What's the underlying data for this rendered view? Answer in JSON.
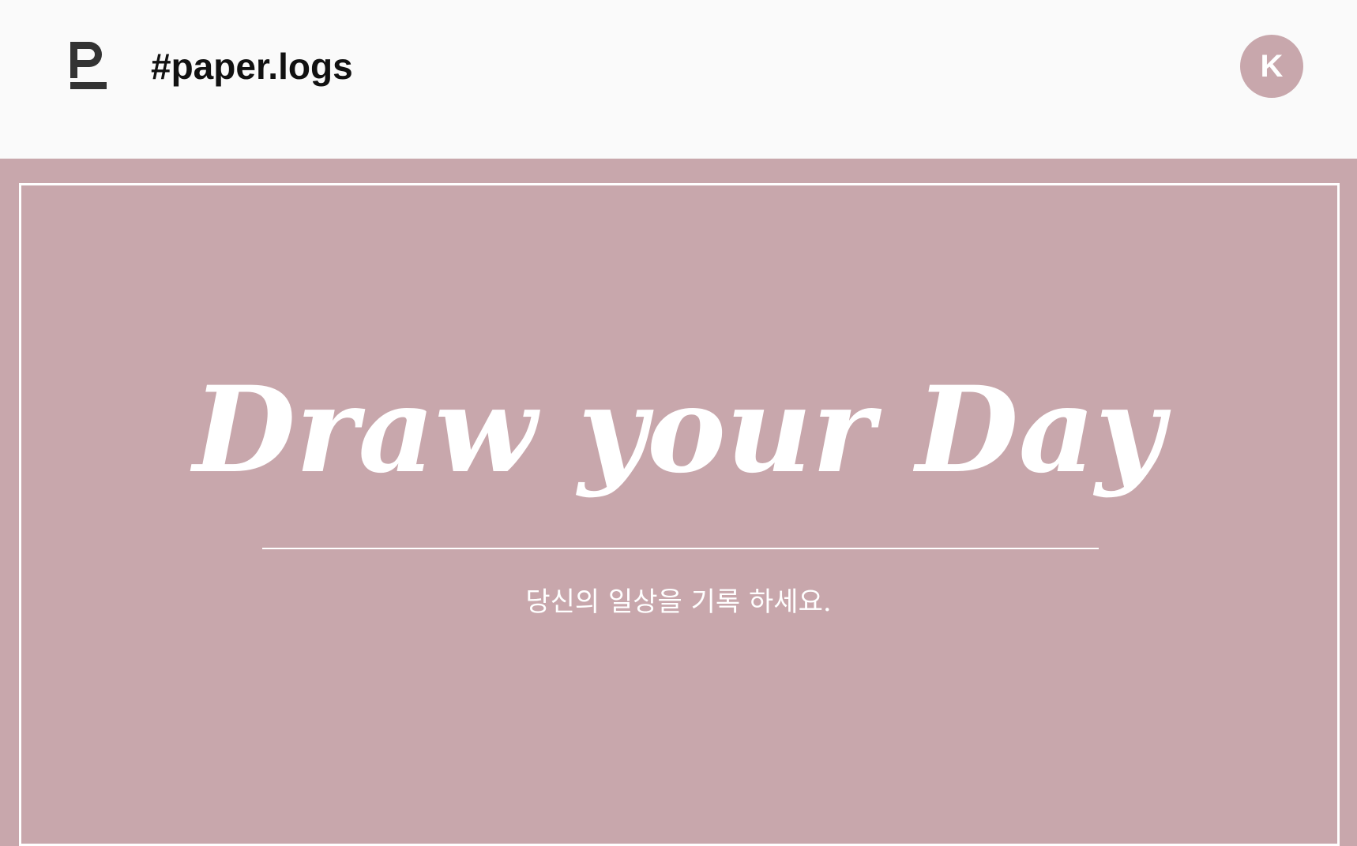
{
  "header": {
    "logo_icon": "paper-logo-icon",
    "title": "#paper.logs",
    "avatar_initial": "K"
  },
  "hero": {
    "headline": "Draw your Day",
    "subtitle": "당신의 일상을 기록 하세요."
  },
  "colors": {
    "accent": "#c8a7ac",
    "header_bg": "#fafafa",
    "text_dark": "#111111",
    "logo": "#333333",
    "white": "#ffffff"
  }
}
